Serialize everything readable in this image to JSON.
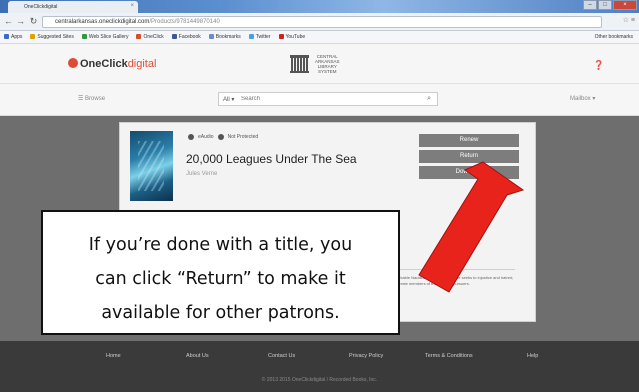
{
  "browser": {
    "tab_title": "OneClickdigital",
    "url_host": "centralarkansas.oneclickdigital.com",
    "url_path": "/Products/9781449870140",
    "bookmarks": [
      "Apps",
      "Suggested Sites",
      "Web Slice Gallery",
      "OneClick",
      "Facebook",
      "Bookmarks",
      "Twitter",
      "YouTube"
    ],
    "bookmark_colors": [
      "#3b6bc4",
      "#e0a100",
      "#2e9a3c",
      "#d84b2c",
      "#3b5998",
      "#6b8ccc",
      "#4aa0e0",
      "#cc2222"
    ],
    "other_bookmarks": "Other bookmarks"
  },
  "header": {
    "logo_strong": "OneClick",
    "logo_light": "digital",
    "library_name_lines": [
      "CENTRAL",
      "ARKANSAS",
      "LIBRARY",
      "SYSTEM"
    ]
  },
  "searchbar": {
    "browse": "Browse",
    "filter": "All",
    "placeholder": "Search",
    "account": "Mailbox"
  },
  "book": {
    "format": "eAudio",
    "status": "Not Protected",
    "title": "20,000 Leagues Under The Sea",
    "author": "Jules Verne",
    "description": "remarkable Nautilus. Its captain, and he seeks to injustice and hatred, desperate members of the sea, the pursuers."
  },
  "actions": {
    "renew": "Renew",
    "return": "Return",
    "download": "Download"
  },
  "footer": {
    "links": [
      "Home",
      "About Us",
      "Contact Us",
      "Privacy Policy",
      "Terms & Conditions",
      "Help"
    ],
    "copyright": "© 2013 2015 OneClickdigital / Recorded Books, Inc."
  },
  "callout": {
    "lines": [
      "If you’re done with a title, you",
      "can click “Return” to make it",
      "available for other patrons."
    ]
  },
  "colors": {
    "arrow": "#e8231c",
    "brand": "#e14b36"
  }
}
